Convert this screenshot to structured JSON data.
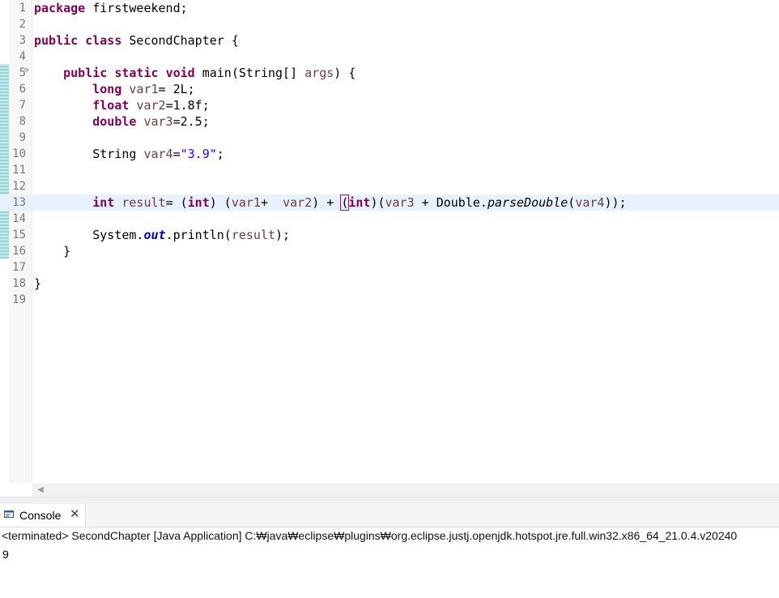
{
  "editor": {
    "lines": [
      {
        "n": "1",
        "tokens": [
          {
            "t": "package",
            "c": "k"
          },
          {
            "t": " firstweekend;"
          }
        ]
      },
      {
        "n": "2",
        "tokens": []
      },
      {
        "n": "3",
        "tokens": [
          {
            "t": "public",
            "c": "k"
          },
          {
            "t": " "
          },
          {
            "t": "class",
            "c": "k"
          },
          {
            "t": " SecondChapter {"
          }
        ]
      },
      {
        "n": "4",
        "tokens": []
      },
      {
        "n": "5",
        "tokens": [
          {
            "t": "    "
          },
          {
            "t": "public",
            "c": "k"
          },
          {
            "t": " "
          },
          {
            "t": "static",
            "c": "k"
          },
          {
            "t": " "
          },
          {
            "t": "void",
            "c": "k"
          },
          {
            "t": " main(String[] "
          },
          {
            "t": "args",
            "c": "v"
          },
          {
            "t": ") {"
          }
        ]
      },
      {
        "n": "6",
        "tokens": [
          {
            "t": "        "
          },
          {
            "t": "long",
            "c": "k"
          },
          {
            "t": " "
          },
          {
            "t": "var1",
            "c": "v"
          },
          {
            "t": "= 2L;"
          }
        ]
      },
      {
        "n": "7",
        "tokens": [
          {
            "t": "        "
          },
          {
            "t": "float",
            "c": "k"
          },
          {
            "t": " "
          },
          {
            "t": "var2",
            "c": "v"
          },
          {
            "t": "=1.8f;"
          }
        ]
      },
      {
        "n": "8",
        "tokens": [
          {
            "t": "        "
          },
          {
            "t": "double",
            "c": "k"
          },
          {
            "t": " "
          },
          {
            "t": "var3",
            "c": "v"
          },
          {
            "t": "=2.5;"
          }
        ]
      },
      {
        "n": "9",
        "tokens": []
      },
      {
        "n": "10",
        "tokens": [
          {
            "t": "        String "
          },
          {
            "t": "var4",
            "c": "v"
          },
          {
            "t": "="
          },
          {
            "t": "\"3.9\"",
            "c": "s"
          },
          {
            "t": ";"
          }
        ]
      },
      {
        "n": "11",
        "tokens": []
      },
      {
        "n": "12",
        "tokens": []
      },
      {
        "n": "13",
        "tokens": [
          {
            "t": "        "
          },
          {
            "t": "int",
            "c": "k"
          },
          {
            "t": " "
          },
          {
            "t": "result",
            "c": "v"
          },
          {
            "t": "= ("
          },
          {
            "t": "int",
            "c": "k"
          },
          {
            "t": ") ("
          },
          {
            "t": "var1",
            "c": "v"
          },
          {
            "t": "+  "
          },
          {
            "t": "var2",
            "c": "v"
          },
          {
            "t": ") + "
          },
          {
            "t": "(",
            "c": "bm"
          },
          {
            "t": "int",
            "c": "k"
          },
          {
            "t": ")("
          },
          {
            "t": "var3",
            "c": "v"
          },
          {
            "t": " + Double."
          },
          {
            "t": "parseDouble",
            "c": "m"
          },
          {
            "t": "("
          },
          {
            "t": "var4",
            "c": "v"
          },
          {
            "t": "));"
          }
        ]
      },
      {
        "n": "14",
        "tokens": []
      },
      {
        "n": "15",
        "tokens": [
          {
            "t": "        System."
          },
          {
            "t": "out",
            "c": "f"
          },
          {
            "t": ".println("
          },
          {
            "t": "result",
            "c": "v"
          },
          {
            "t": ");"
          }
        ]
      },
      {
        "n": "16",
        "tokens": [
          {
            "t": "    }"
          }
        ]
      },
      {
        "n": "17",
        "tokens": []
      },
      {
        "n": "18",
        "tokens": [
          {
            "t": "}"
          }
        ]
      },
      {
        "n": "19",
        "tokens": []
      }
    ],
    "current_line": "13",
    "fold_marker": "⊖",
    "scroll_left_icon": "◀"
  },
  "console": {
    "tab_icon": "console-icon",
    "tab_title": "Console",
    "close_glyph": "✕",
    "status": "<terminated> SecondChapter [Java Application] C:₩java₩eclipse₩plugins₩org.eclipse.justj.openjdk.hotspot.jre.full.win32.x86_64_21.0.4.v20240",
    "output": "9"
  },
  "colors": {
    "keyword": "#7f0055",
    "variable": "#6a3e3e",
    "string": "#2a00ff",
    "field": "#0000c0",
    "current_line_bg": "#e8f2fe"
  }
}
